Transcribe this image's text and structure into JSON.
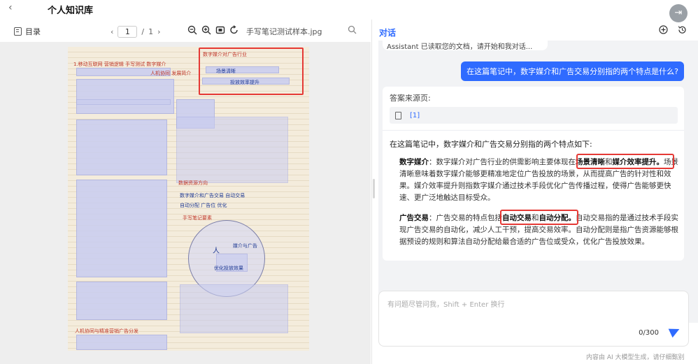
{
  "header": {
    "back_glyph": "‹",
    "title": "个人知识库",
    "exit_glyph": "⇥"
  },
  "pdf_toolbar": {
    "toc_label": "目录",
    "prev_glyph": "‹",
    "page_current": "1",
    "page_sep": "/",
    "page_total": "1",
    "next_glyph": "›",
    "file_name": "手写笔记测试样本.jpg",
    "icons": [
      "zoom-out-icon",
      "zoom-in-icon",
      "fit-screen-icon",
      "rotate-icon",
      "search-icon"
    ]
  },
  "document_notes": {
    "top_heading": "1.移动互联网 营销逻辑 手写测试 数字媒介",
    "side_note": "人机协同 发展简介",
    "box1": "数字媒介对广告行业",
    "box2": "场景清晰",
    "box3": "投放效率提升",
    "section_head": "数据资源方向",
    "mid_note1": "数字媒介和广告交易 自动交易",
    "mid_note2": "自动分配 广告位 优化",
    "circle_title": "手写笔记要素",
    "circle_a": "人",
    "circle_b": "媒介与广告",
    "circle_c": "优化投放效果",
    "bottom_head": "人机协同与精准营销广告分发"
  },
  "chat": {
    "title": "对话",
    "head_icons": [
      "new-chat-icon",
      "history-icon"
    ],
    "system_message": "Assistant 已读取您的文档，请开始和我对话...",
    "user_question": "在这篇笔记中，数字媒介和广告交易分别指的两个特点是什么?",
    "source_title": "答案来源页:",
    "source_ref": "[1]",
    "intro": "在这篇笔记中，数字媒介和广告交易分别指的两个特点如下:",
    "p1_label": "数字媒介",
    "p1_a": "：数字媒介对广告行业的供需影响主要体现在",
    "p1_b1": "场景清晰",
    "p1_and": "和",
    "p1_b2": "媒介效率提升。",
    "p1_rest": "场景清晰意味着数字媒介能够更精准地定位广告投放的场景，从而提高广告的针对性和效果。媒介效率提升则指数字媒介通过技术手段优化广告传播过程，使得广告能够更快速、更广泛地触达目标受众。",
    "p2_label": "广告交易",
    "p2_a": "：广告交易的特点包括",
    "p2_b1": "自动交易",
    "p2_and": "和",
    "p2_b2": "自动分配。",
    "p2_rest": "自动交易指的是通过技术手段实现广告交易的自动化，减少人工干预，提高交易效率。自动分配则是指广告资源能够根据预设的规则和算法自动分配给最合适的广告位或受众，优化广告投放效果。"
  },
  "composer": {
    "placeholder": "有问题尽管问我，Shift + Enter 换行",
    "counter": "0/300"
  },
  "footer": {
    "disclaimer": "内容由 AI 大模型生成，请仔细甄别"
  },
  "colors": {
    "accent": "#2f6bff",
    "highlight_red": "#e53935",
    "chat_bg": "#f2f3f5"
  }
}
